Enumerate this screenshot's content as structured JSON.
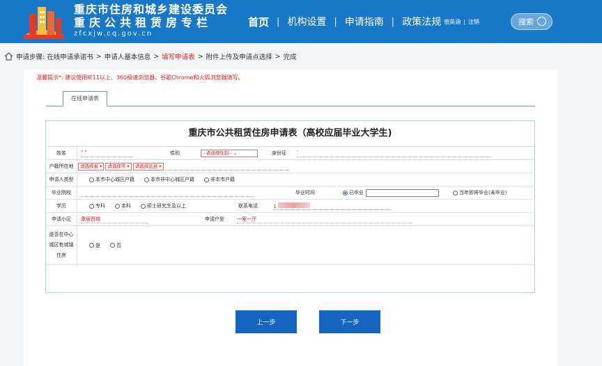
{
  "header": {
    "logo_line1": "重庆市住房和城乡建设委员会",
    "logo_line2": "重庆公共租赁房专栏",
    "logo_line3": "zfcxjw.cq.gov.cn",
    "nav": [
      "首页",
      "机构设置",
      "申请指南",
      "政策法规"
    ],
    "nav_small": [
      "密英涵",
      "注销"
    ],
    "search_label": "搜索"
  },
  "breadcrumb": {
    "prefix": "申请步骤:",
    "steps": [
      "在线申请承诺书",
      "申请人基本信息",
      "填写申请表",
      "附件上传及申请点选择",
      "完成"
    ],
    "active_index": 2
  },
  "tip": "温馨提示*: 建议使用IE11以上、360极速浏览器、谷歌Chrome和火狐浏览器填写。",
  "tab_label": "在线申请表",
  "form": {
    "title": "重庆市公共租赁住房申请表（高校应届毕业大学生)",
    "name_label": "姓名",
    "name_value": "\"     \"",
    "gender_label": "性别",
    "gender_select": "--请选择性别--",
    "id_label": "身份证",
    "id_value": "'",
    "household_label": "户籍所在地",
    "province_select": "请选择省",
    "city_select": "请选择市",
    "district_select": "请选择区县",
    "applicant_type_label": "申请人类型",
    "applicant_types": [
      "本市中心城区户籍",
      "本市非中心城区户籍",
      "非本市户籍"
    ],
    "school_label": "毕业院校",
    "grad_time_label": "毕业时间",
    "grad_options": [
      "已毕业",
      "当年即将毕业(未毕业)"
    ],
    "education_label": "学历",
    "education_options": [
      "专科",
      "本科",
      "硕士研究生及以上"
    ],
    "phone_label": "联系电话",
    "phone_value": "1",
    "community_label": "申请小区",
    "community_value": "康居西城",
    "house_type_label": "申请户型",
    "house_type_value": "一室一厅",
    "owns_house_label1": "是否在中心",
    "owns_house_label2": "城区有城镇",
    "owns_house_label3": "住房",
    "yes_no": [
      "是",
      "否"
    ]
  },
  "buttons": {
    "prev": "上一步",
    "next": "下一步"
  },
  "colors": {
    "header": "#1878c8",
    "active": "#e02020",
    "button": "#1565c0"
  }
}
